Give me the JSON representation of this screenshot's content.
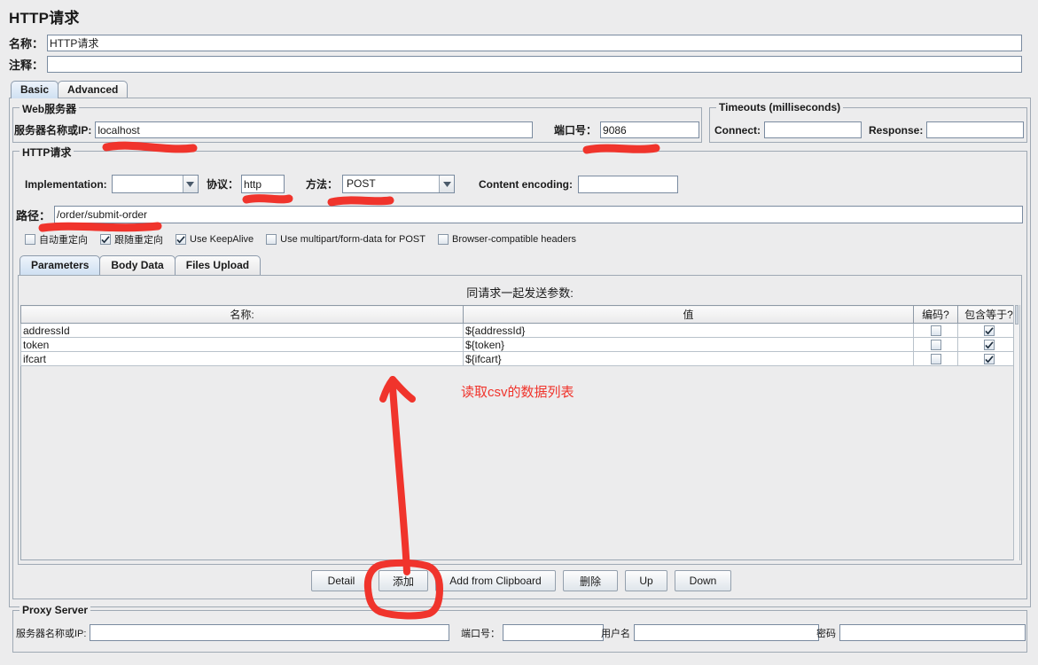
{
  "window": {
    "title": "HTTP请求"
  },
  "header": {
    "name_label": "名称：",
    "name_value": "HTTP请求",
    "comment_label": "注释：",
    "comment_value": ""
  },
  "main_tabs": [
    {
      "label": "Basic",
      "active": true
    },
    {
      "label": "Advanced",
      "active": false
    }
  ],
  "web_server": {
    "title": "Web服务器",
    "server_label": "服务器名称或IP:",
    "server_value": "localhost",
    "port_label": "端口号：",
    "port_value": "9086"
  },
  "timeouts": {
    "title": "Timeouts (milliseconds)",
    "connect_label": "Connect:",
    "connect_value": "",
    "response_label": "Response:",
    "response_value": ""
  },
  "http_request": {
    "title": "HTTP请求",
    "implementation_label": "Implementation:",
    "implementation_value": "",
    "protocol_label": "协议：",
    "protocol_value": "http",
    "method_label": "方法：",
    "method_value": "POST",
    "content_encoding_label": "Content encoding:",
    "content_encoding_value": "",
    "path_label": "路径：",
    "path_value": "/order/submit-order",
    "checkboxes": [
      {
        "label": "自动重定向",
        "checked": false
      },
      {
        "label": "跟随重定向",
        "checked": true
      },
      {
        "label": "Use KeepAlive",
        "checked": true
      },
      {
        "label": "Use multipart/form-data for POST",
        "checked": false
      },
      {
        "label": "Browser-compatible headers",
        "checked": false
      }
    ]
  },
  "param_tabs": [
    {
      "label": "Parameters",
      "active": true
    },
    {
      "label": "Body Data",
      "active": false
    },
    {
      "label": "Files Upload",
      "active": false
    }
  ],
  "parameters_panel": {
    "caption": "同请求一起发送参数:",
    "columns": [
      "名称:",
      "值",
      "编码?",
      "包含等于?"
    ],
    "rows": [
      {
        "name": "addressId",
        "value": "${addressId}",
        "encode": false,
        "include_equals": true
      },
      {
        "name": "token",
        "value": "${token}",
        "encode": false,
        "include_equals": true
      },
      {
        "name": "ifcart",
        "value": "${ifcart}",
        "encode": false,
        "include_equals": true
      }
    ],
    "buttons": [
      {
        "label": "Detail"
      },
      {
        "label": "添加"
      },
      {
        "label": "Add from Clipboard"
      },
      {
        "label": "删除"
      },
      {
        "label": "Up"
      },
      {
        "label": "Down"
      }
    ]
  },
  "proxy_server": {
    "title": "Proxy Server",
    "server_label": "服务器名称或IP:",
    "server_value": "",
    "port_label": "端口号：",
    "port_value": "",
    "username_label": "用户名",
    "username_value": "",
    "password_label": "密码",
    "password_value": ""
  },
  "annotations": {
    "color": "#f0342c",
    "csv_note": "读取csv的数据列表"
  }
}
